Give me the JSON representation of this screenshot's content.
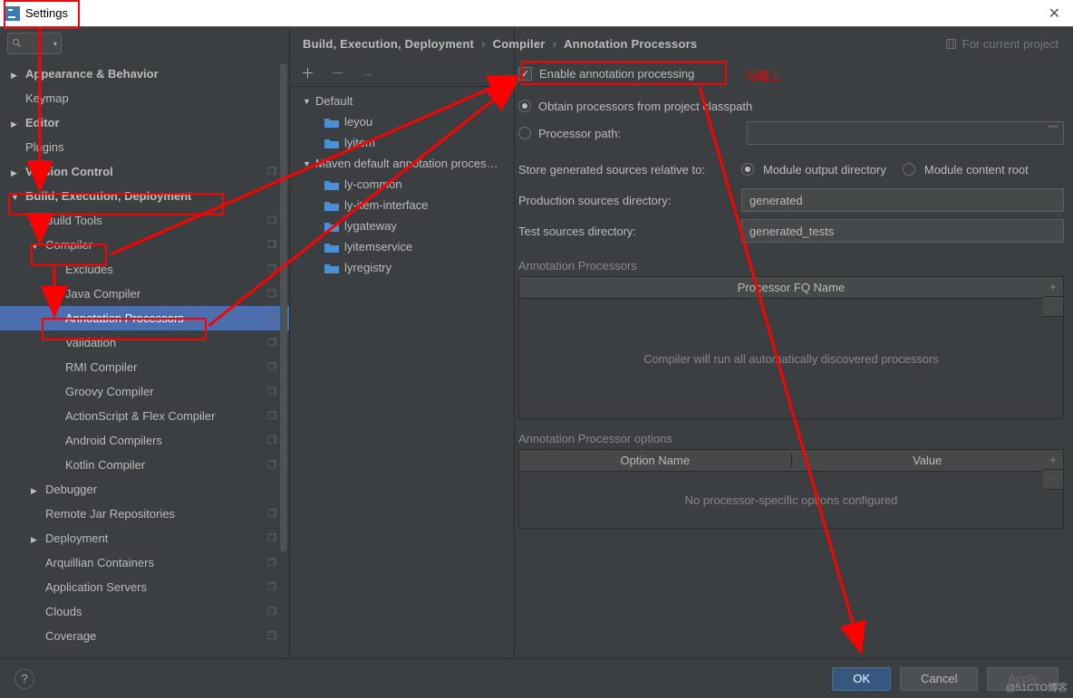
{
  "window": {
    "title": "Settings"
  },
  "sidebar": {
    "items": [
      {
        "label": "Appearance & Behavior",
        "state": "collapsed",
        "bold": true
      },
      {
        "label": "Keymap",
        "state": "none"
      },
      {
        "label": "Editor",
        "state": "collapsed",
        "bold": true
      },
      {
        "label": "Plugins",
        "state": "none"
      },
      {
        "label": "Version Control",
        "state": "collapsed",
        "bold": true,
        "copy": true
      },
      {
        "label": "Build, Execution, Deployment",
        "state": "expanded",
        "bold": true
      },
      {
        "label": "Build Tools",
        "state": "collapsed",
        "indent": 1,
        "copy": true
      },
      {
        "label": "Compiler",
        "state": "expanded",
        "indent": 1,
        "copy": true
      },
      {
        "label": "Excludes",
        "state": "none",
        "indent": 2,
        "copy": true
      },
      {
        "label": "Java Compiler",
        "state": "none",
        "indent": 2,
        "copy": true
      },
      {
        "label": "Annotation Processors",
        "state": "none",
        "indent": 2,
        "selected": true,
        "copy": true
      },
      {
        "label": "Validation",
        "state": "none",
        "indent": 2,
        "copy": true
      },
      {
        "label": "RMI Compiler",
        "state": "none",
        "indent": 2,
        "copy": true
      },
      {
        "label": "Groovy Compiler",
        "state": "none",
        "indent": 2,
        "copy": true
      },
      {
        "label": "ActionScript & Flex Compiler",
        "state": "none",
        "indent": 2,
        "copy": true
      },
      {
        "label": "Android Compilers",
        "state": "none",
        "indent": 2,
        "copy": true
      },
      {
        "label": "Kotlin Compiler",
        "state": "none",
        "indent": 2,
        "copy": true
      },
      {
        "label": "Debugger",
        "state": "collapsed",
        "indent": 1
      },
      {
        "label": "Remote Jar Repositories",
        "state": "none",
        "indent": 1,
        "copy": true
      },
      {
        "label": "Deployment",
        "state": "collapsed",
        "indent": 1,
        "copy": true
      },
      {
        "label": "Arquillian Containers",
        "state": "none",
        "indent": 1,
        "copy": true
      },
      {
        "label": "Application Servers",
        "state": "none",
        "indent": 1,
        "copy": true
      },
      {
        "label": "Clouds",
        "state": "none",
        "indent": 1,
        "copy": true
      },
      {
        "label": "Coverage",
        "state": "none",
        "indent": 1,
        "copy": true
      }
    ]
  },
  "breadcrumb": [
    "Build, Execution, Deployment",
    "Compiler",
    "Annotation Processors"
  ],
  "project_label": "For current project",
  "modules": {
    "groups": [
      {
        "name": "Default",
        "items": [
          "leyou",
          "lyitem"
        ]
      },
      {
        "name": "Maven default annotation proces…",
        "items": [
          "ly-common",
          "ly-item-interface",
          "lygateway",
          "lyitemservice",
          "lyregistry"
        ]
      }
    ]
  },
  "form": {
    "enable": "Enable annotation processing",
    "obtain": "Obtain processors from project classpath",
    "processor_path": "Processor path:",
    "store_relative": "Store generated sources relative to:",
    "module_output": "Module output directory",
    "module_content": "Module content root",
    "prod_dir_label": "Production sources directory:",
    "prod_dir_value": "generated",
    "test_dir_label": "Test sources directory:",
    "test_dir_value": "generated_tests",
    "processors_section": "Annotation Processors",
    "processors_header": "Processor FQ Name",
    "processors_empty": "Compiler will run all automatically discovered processors",
    "options_section": "Annotation Processor options",
    "options_h1": "Option Name",
    "options_h2": "Value",
    "options_empty": "No processor-specific options configured"
  },
  "footer": {
    "ok": "OK",
    "cancel": "Cancel",
    "apply": "Apply"
  },
  "annotation": {
    "note": "勾选上"
  },
  "watermark": "@51CTO博客"
}
